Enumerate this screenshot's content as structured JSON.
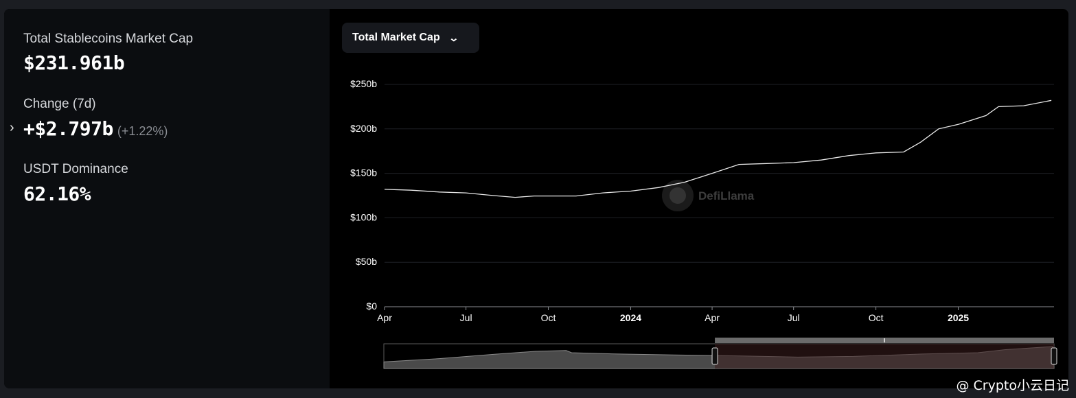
{
  "stats": {
    "total_label": "Total Stablecoins Market Cap",
    "total_value": "$231.961b",
    "change_label": "Change (7d)",
    "change_value": "+$2.797b",
    "change_percent": "(+1.22%)",
    "dominance_label": "USDT Dominance",
    "dominance_value": "62.16%"
  },
  "dropdown": {
    "label": "Total Market Cap"
  },
  "logo": {
    "text": "DefiLlama"
  },
  "watermark": {
    "text": "@ Crypto小云日记"
  },
  "chart_data": {
    "type": "line",
    "series": [
      {
        "values": [
          [
            "2023-04-01",
            132
          ],
          [
            "2023-05-01",
            131
          ],
          [
            "2023-06-01",
            129
          ],
          [
            "2023-07-01",
            128
          ],
          [
            "2023-08-01",
            125
          ],
          [
            "2023-08-25",
            123
          ],
          [
            "2023-09-15",
            124.5
          ],
          [
            "2023-10-01",
            124.5
          ],
          [
            "2023-11-01",
            124.5
          ],
          [
            "2023-12-01",
            128
          ],
          [
            "2024-01-01",
            130
          ],
          [
            "2024-02-01",
            134
          ],
          [
            "2024-03-01",
            140
          ],
          [
            "2024-04-01",
            150
          ],
          [
            "2024-05-01",
            160
          ],
          [
            "2024-06-01",
            161
          ],
          [
            "2024-07-01",
            162
          ],
          [
            "2024-08-01",
            165
          ],
          [
            "2024-09-01",
            170
          ],
          [
            "2024-10-01",
            173
          ],
          [
            "2024-11-01",
            174
          ],
          [
            "2024-11-20",
            185
          ],
          [
            "2024-12-10",
            200
          ],
          [
            "2025-01-01",
            205
          ],
          [
            "2025-02-01",
            215
          ],
          [
            "2025-02-15",
            225
          ],
          [
            "2025-03-15",
            226
          ],
          [
            "2025-04-15",
            232
          ]
        ]
      }
    ],
    "x_ticks": [
      {
        "date": "2023-04-01",
        "label": "Apr",
        "bold": false
      },
      {
        "date": "2023-07-01",
        "label": "Jul",
        "bold": false
      },
      {
        "date": "2023-10-01",
        "label": "Oct",
        "bold": false
      },
      {
        "date": "2024-01-01",
        "label": "2024",
        "bold": true
      },
      {
        "date": "2024-04-01",
        "label": "Apr",
        "bold": false
      },
      {
        "date": "2024-07-01",
        "label": "Jul",
        "bold": false
      },
      {
        "date": "2024-10-01",
        "label": "Oct",
        "bold": false
      },
      {
        "date": "2025-01-01",
        "label": "2025",
        "bold": true
      }
    ],
    "y_ticks": [
      {
        "value": 0,
        "label": "$0"
      },
      {
        "value": 50,
        "label": "$50b"
      },
      {
        "value": 100,
        "label": "$100b"
      },
      {
        "value": 150,
        "label": "$150b"
      },
      {
        "value": 200,
        "label": "$200b"
      },
      {
        "value": 250,
        "label": "$250b"
      }
    ],
    "xlim": [
      "2023-04-01",
      "2025-04-18"
    ],
    "ylim": [
      0,
      250
    ],
    "grid": true,
    "overview": {
      "full_series": [
        [
          "2021-04-01",
          0.3
        ],
        [
          "2021-08-01",
          0.45
        ],
        [
          "2021-12-01",
          0.65
        ],
        [
          "2022-03-01",
          0.78
        ],
        [
          "2022-05-08",
          0.82
        ],
        [
          "2022-05-20",
          0.72
        ],
        [
          "2022-09-01",
          0.66
        ],
        [
          "2023-01-01",
          0.62
        ],
        [
          "2023-06-01",
          0.57
        ],
        [
          "2023-10-01",
          0.52
        ],
        [
          "2024-02-01",
          0.55
        ],
        [
          "2024-07-01",
          0.66
        ],
        [
          "2024-11-01",
          0.72
        ],
        [
          "2025-01-01",
          0.86
        ],
        [
          "2025-04-15",
          1.0
        ]
      ],
      "full_range": [
        "2021-04-01",
        "2025-04-18"
      ],
      "selected_range": [
        "2023-04-01",
        "2025-04-18"
      ]
    },
    "colors": {
      "line": "#e9e9e9",
      "grid": "#1e2126",
      "axis": "#8a8d92",
      "overview_fill": "#4a4a4a",
      "selected_fill": "#3b1e1e"
    }
  }
}
